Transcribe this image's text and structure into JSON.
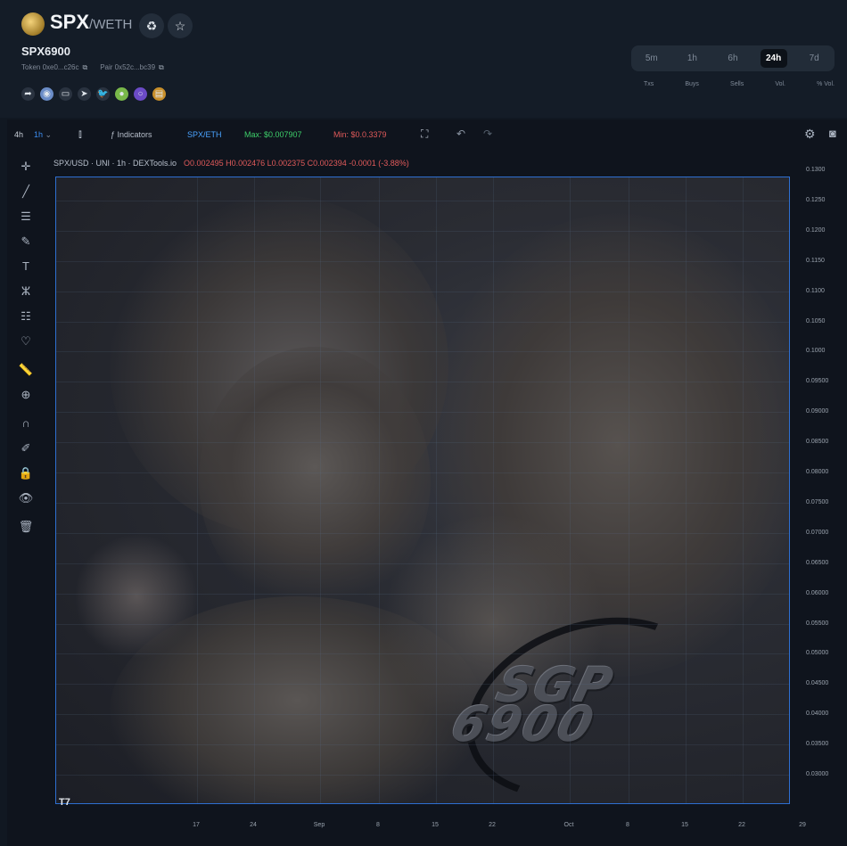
{
  "header": {
    "base": "SPX",
    "quote": "/WETH",
    "full_name": "SPX6900",
    "token_addr": "Token 0xe0...c26c",
    "pair_addr": "Pair 0x52c...bc39",
    "timeframes": [
      {
        "label": "5m",
        "active": false
      },
      {
        "label": "1h",
        "active": false
      },
      {
        "label": "6h",
        "active": false
      },
      {
        "label": "24h",
        "active": true
      },
      {
        "label": "7d",
        "active": false
      }
    ],
    "stat_labels": [
      "Txs",
      "Buys",
      "Sells",
      "Vol.",
      "% Vol."
    ]
  },
  "toolbar": {
    "interval_main": "4h",
    "interval_sel": "1h",
    "indicators": "Indicators",
    "pair": "SPX/ETH",
    "max": "Max: $0.007907",
    "min": "Min: $0.0.3379"
  },
  "legend": {
    "title": "SPX/USD · UNI · 1h · DEXTools.io",
    "ohlc": "O0.002495 H0.002476 L0.002375 C0.002394 -0.0001 (-3.88%)"
  },
  "overlay_text": [
    "SGP",
    "6900"
  ],
  "chart_data": {
    "type": "line",
    "series": [],
    "y_ticks": [
      "0.1300",
      "0.1250",
      "0.1200",
      "0.1150",
      "0.1100",
      "0.1050",
      "0.1000",
      "0.09500",
      "0.09000",
      "0.08500",
      "0.08000",
      "0.07500",
      "0.07000",
      "0.06500",
      "0.06000",
      "0.05500",
      "0.05000",
      "0.04500",
      "0.04000",
      "0.03500",
      "0.03000"
    ],
    "x_ticks": [
      "17",
      "24",
      "Sep",
      "8",
      "15",
      "22",
      "Oct",
      "8",
      "15",
      "22",
      "29"
    ],
    "grid": true
  },
  "colors": {
    "accent": "#2e6fd1",
    "max": "#3ecf6a",
    "min": "#e05a5a",
    "pair": "#4aa3ff"
  }
}
